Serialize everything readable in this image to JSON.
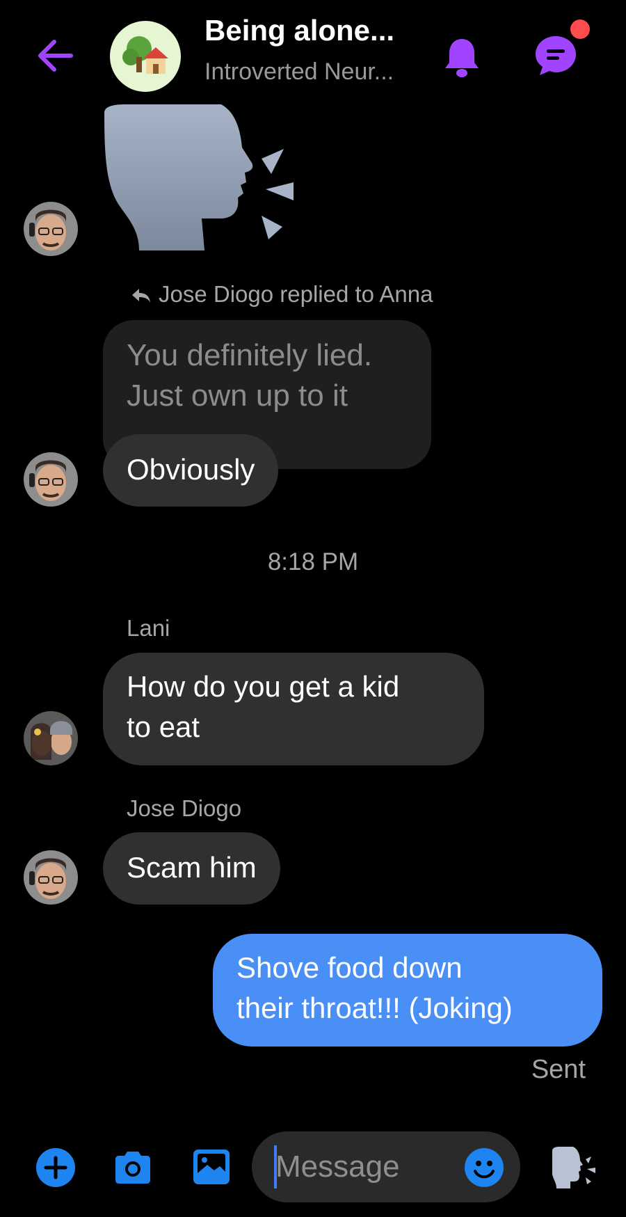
{
  "header": {
    "title": "Being alone...",
    "subtitle": "Introverted Neur...",
    "group_icon": "house-with-tree-icon",
    "back_icon": "back-arrow-icon",
    "bell_icon": "bell-icon",
    "chat_icon": "chat-bubble-icon",
    "accent_color": "#a044ff",
    "notification_dot_color": "#ff4b4b"
  },
  "messages": {
    "speaking_head_sticker": "speaking-head-icon",
    "reply_label": "Jose Diogo replied to Anna",
    "quoted_text_line1": "You definitely lied.",
    "quoted_text_line2": "Just own up to it",
    "reply_text": "Obviously",
    "timestamp": "8:18 PM",
    "lani_name": "Lani",
    "lani_line1": "How do you get a kid",
    "lani_line2": "to eat",
    "jose_name": "Jose Diogo",
    "jose_text": "Scam him",
    "me_line1": "Shove food down",
    "me_line2": "their throat!!! (Joking)",
    "status": "Sent",
    "me_bubble_color": "#4a8ff5"
  },
  "composer": {
    "placeholder": "Message",
    "plus_icon": "plus-icon",
    "camera_icon": "camera-icon",
    "gallery_icon": "image-icon",
    "emoji_icon": "emoji-icon",
    "send_icon": "speaking-head-icon"
  }
}
